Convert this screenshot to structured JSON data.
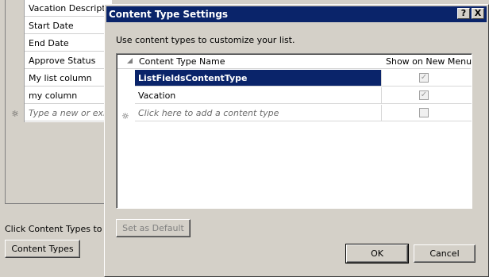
{
  "background": {
    "columns": [
      "Vacation Description",
      "Start Date",
      "End Date",
      "Approve Status",
      "My list column",
      "my column"
    ],
    "new_row_placeholder": "Type a new or existing column name",
    "new_row_icon": "new-row-star-icon",
    "hint_text": "Click Content Types to add",
    "content_types_button": "Content Types"
  },
  "dialog": {
    "title": "Content Type Settings",
    "help_button": "?",
    "close_button": "X",
    "instruction": "Use content types to customize your list.",
    "grid": {
      "columns": [
        "Content Type Name",
        "Show on New Menu"
      ],
      "rows": [
        {
          "name": "ListFieldsContentType",
          "show_on_new_menu": true,
          "selected": true
        },
        {
          "name": "Vacation",
          "show_on_new_menu": true,
          "selected": false
        }
      ],
      "new_row_placeholder": "Click here to add a content type",
      "new_row_checked": false,
      "new_row_icon": "new-row-star-icon",
      "checkmark_glyph": "✓"
    },
    "set_default_button": "Set as Default",
    "ok_button": "OK",
    "cancel_button": "Cancel"
  },
  "colors": {
    "selection": "#0a246a",
    "titlebar": "#0a246a",
    "face": "#d4d0c8"
  }
}
